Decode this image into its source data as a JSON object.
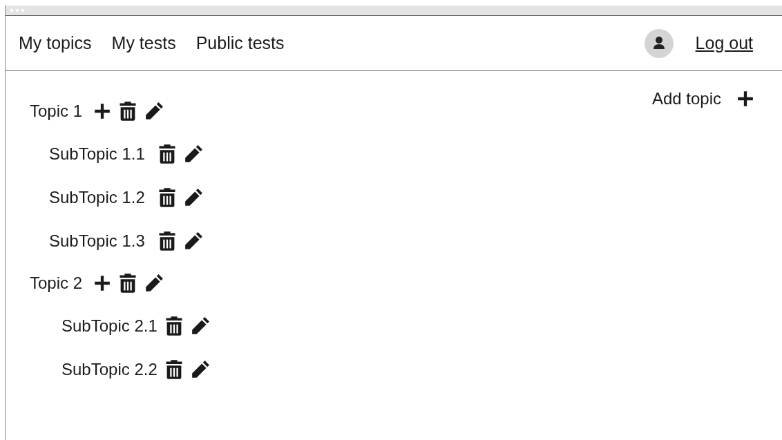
{
  "nav": {
    "links": [
      "My topics",
      "My tests",
      "Public tests"
    ],
    "logout": "Log out"
  },
  "add_topic": "Add topic",
  "topics": [
    {
      "name": "Topic 1",
      "children": [
        {
          "name": "SubTopic 1.1"
        },
        {
          "name": "SubTopic 1.2"
        },
        {
          "name": "SubTopic 1.3"
        }
      ]
    },
    {
      "name": "Topic 2",
      "children": [
        {
          "name": "SubTopic 2.1"
        },
        {
          "name": "SubTopic 2.2"
        }
      ]
    }
  ]
}
